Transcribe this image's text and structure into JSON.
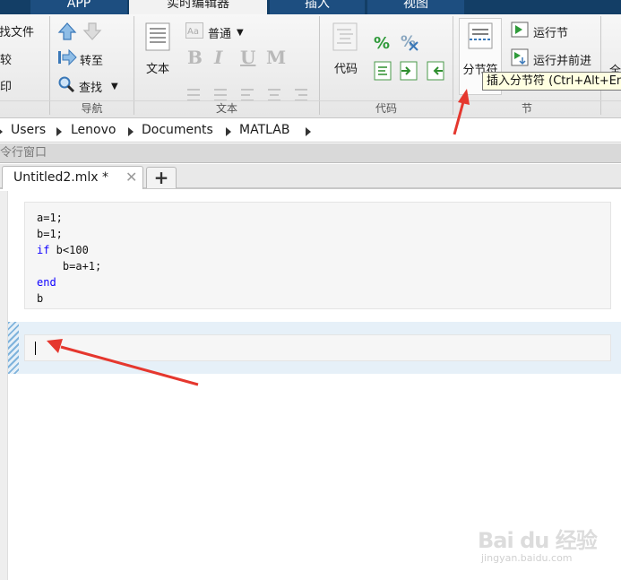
{
  "tabs": {
    "app": "APP",
    "live_editor": "实时编辑器",
    "insert": "插入",
    "view": "视图"
  },
  "ribbon": {
    "file": {
      "find_files": "查找文件",
      "compare": "比较",
      "print": "打印"
    },
    "navigate": {
      "goto": "转至",
      "find": "查找",
      "group_label": "导航"
    },
    "text": {
      "text_button": "文本",
      "style_value": "普通",
      "group_label": "文本"
    },
    "code": {
      "code_button": "代码",
      "group_label": "代码"
    },
    "section": {
      "section_break": "分节符",
      "run_section": "运行节",
      "run_and_advance": "运行并前进",
      "group_label": "节"
    },
    "run": {
      "partial_label": "全"
    }
  },
  "tooltip": "插入分节符 (Ctrl+Alt+Enter)",
  "address": {
    "crumbs": [
      "Users",
      "Lenovo",
      "Documents",
      "MATLAB"
    ]
  },
  "command_window": {
    "title": "命令行窗口"
  },
  "file_tab": {
    "name": "Untitled2.mlx *",
    "close": "✕",
    "add": "+"
  },
  "editor": {
    "lines": [
      "a=1;",
      "b=1;",
      "if b<100",
      "    b=a+1;",
      "end",
      "b"
    ],
    "keywords": [
      "if",
      "end"
    ]
  },
  "watermark": {
    "brand": "Bai du 经验",
    "url": "jingyan.baidu.com"
  },
  "colors": {
    "tab_bar": "#133e66",
    "tab_active": "#f2f2f2",
    "keyword": "#0e00ff",
    "section_highlight": "#e6f0f8",
    "tooltip_bg": "#ffffe1",
    "annotation_arrow": "#e5372e"
  }
}
